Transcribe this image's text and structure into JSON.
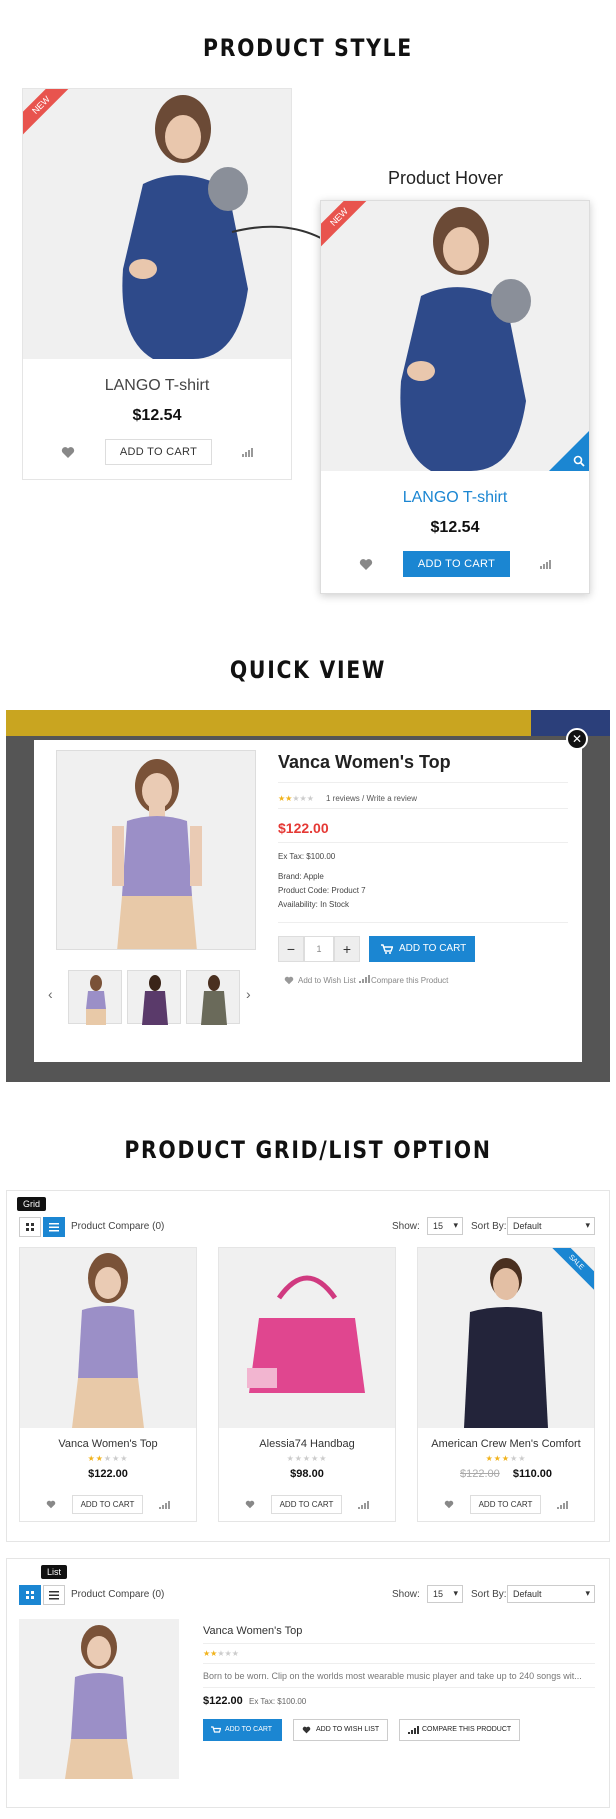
{
  "sections": {
    "style_title": "PRODUCT STYLE",
    "hover_caption": "Product Hover",
    "quickview_title": "QUICK VIEW",
    "gridlist_title": "PRODUCT GRID/LIST OPTION"
  },
  "style_cards": [
    {
      "badge": "NEW",
      "name": "LANGO T-shirt",
      "price": "$12.54",
      "cart_label": "ADD TO CART"
    },
    {
      "badge": "NEW",
      "name": "LANGO T-shirt",
      "price": "$12.54",
      "cart_label": "ADD TO CART"
    }
  ],
  "quickview": {
    "title": "Vanca Women's Top",
    "reviews": "1 reviews / Write a review",
    "price": "$122.00",
    "ex_tax": "Ex Tax: $100.00",
    "brand": "Brand: Apple",
    "code": "Product Code: Product 7",
    "availability": "Availability: In Stock",
    "qty": "1",
    "cart_label": "ADD TO CART",
    "wishlist": "Add to Wish List",
    "compare": "Compare this Product"
  },
  "toolbar": {
    "grid_tooltip": "Grid",
    "list_tooltip": "List",
    "compare": "Product Compare (0)",
    "show_label": "Show:",
    "show_value": "15",
    "sort_label": "Sort By:",
    "sort_value": "Default"
  },
  "grid_products": [
    {
      "name": "Vanca Women's Top",
      "price": "$122.00",
      "old_price": "",
      "stars": 2,
      "cart": "ADD TO CART"
    },
    {
      "name": "Alessia74 Handbag",
      "price": "$98.00",
      "old_price": "",
      "stars": 0,
      "cart": "ADD TO CART"
    },
    {
      "name": "American Crew Men's Comfort",
      "price": "$110.00",
      "old_price": "$122.00",
      "stars": 3,
      "cart": "ADD TO CART",
      "badge": "SALE"
    }
  ],
  "list_product": {
    "name": "Vanca Women's Top",
    "desc": "Born to be worn. Clip on the worlds most wearable music player and take up to 240 songs wit...",
    "price": "$122.00",
    "ex_tax": "Ex Tax: $100.00",
    "cart": "ADD TO CART",
    "wishlist": "ADD TO WISH LIST",
    "compare": "COMPARE THIS PRODUCT"
  },
  "colors": {
    "accent": "#1b86d2",
    "sale_price": "#e53935",
    "badge_new": "#e8544e",
    "star": "#f1b31c"
  }
}
